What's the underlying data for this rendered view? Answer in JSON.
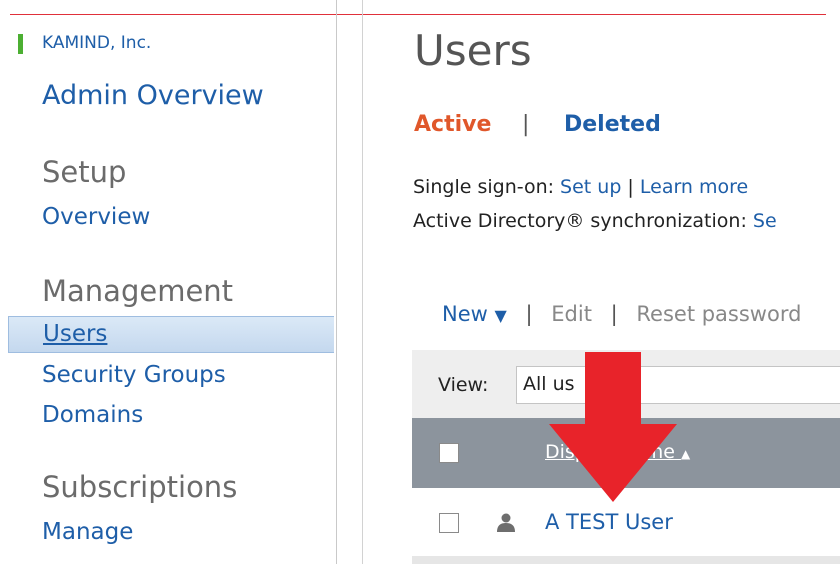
{
  "sidebar": {
    "org_name": "KAMIND, Inc.",
    "admin_overview": "Admin Overview",
    "setup": {
      "title": "Setup",
      "items": [
        "Overview"
      ]
    },
    "management": {
      "title": "Management",
      "items": [
        "Users",
        "Security Groups",
        "Domains"
      ],
      "selected": "Users"
    },
    "subscriptions": {
      "title": "Subscriptions",
      "items": [
        "Manage"
      ]
    }
  },
  "main": {
    "title": "Users",
    "tabs": {
      "active": "Active",
      "separator": "|",
      "deleted": "Deleted"
    },
    "sso": {
      "label": "Single sign-on: ",
      "setup_link": "Set up",
      "sep": " | ",
      "learn_link": "Learn more"
    },
    "ad_sync": {
      "label": "Active Directory® synchronization: ",
      "link": "Se"
    },
    "toolbar": {
      "new": "New",
      "new_icon": "caret-down-icon",
      "sep": "|",
      "edit": "Edit",
      "reset": "Reset password"
    },
    "view": {
      "label": "View:",
      "value": "All us"
    },
    "table": {
      "column": "Display name",
      "sort_icon": "sort-ascending-icon",
      "rows": [
        {
          "name": "A TEST User",
          "icon": "user-icon"
        }
      ]
    }
  },
  "colors": {
    "accent_blue": "#1e5ea8",
    "active_orange": "#e0572a",
    "header_gray": "#8c949d",
    "arrow_red": "#e8232a",
    "org_green": "#4caf32"
  }
}
